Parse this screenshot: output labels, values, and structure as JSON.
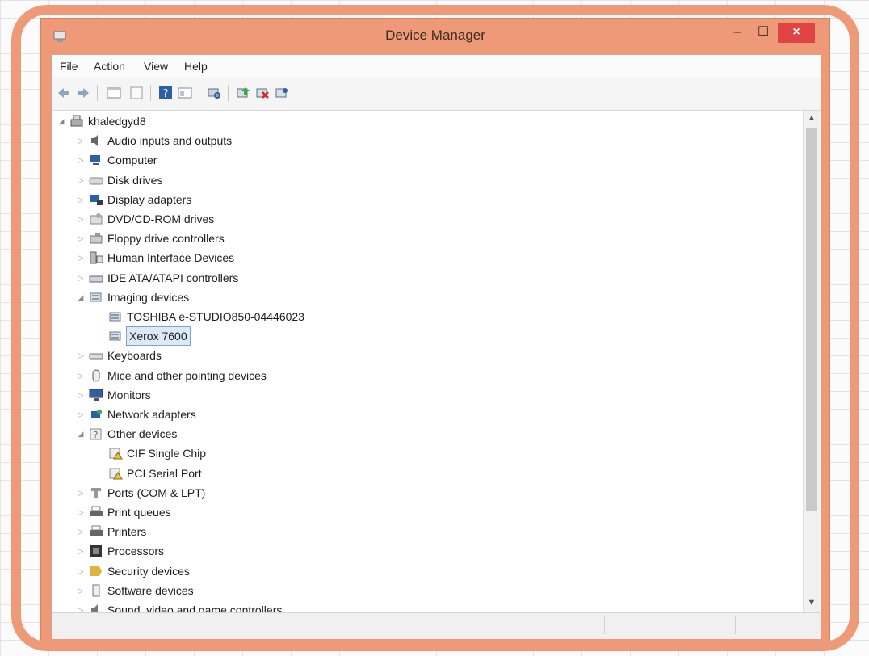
{
  "window": {
    "title": "Device Manager",
    "minimize_glyph": "–",
    "maximize_glyph": "☐",
    "close_glyph": "×"
  },
  "menu": [
    "File",
    "Action",
    "View",
    "Help"
  ],
  "toolbar": {
    "buttons": [
      "back-icon",
      "forward-icon",
      "properties-pane-icon",
      "blank-icon",
      "help-icon",
      "view-icon",
      "scan-hardware-icon",
      "update-driver-icon",
      "disable-device-icon",
      "uninstall-device-icon"
    ]
  },
  "tree": {
    "root": "khaledgyd8",
    "items": [
      {
        "label": "Audio inputs and outputs",
        "icon": "speaker-icon",
        "expanded": false
      },
      {
        "label": "Computer",
        "icon": "computer-icon",
        "expanded": false
      },
      {
        "label": "Disk drives",
        "icon": "disk-icon",
        "expanded": false
      },
      {
        "label": "Display adapters",
        "icon": "display-icon",
        "expanded": false
      },
      {
        "label": "DVD/CD-ROM drives",
        "icon": "dvd-icon",
        "expanded": false
      },
      {
        "label": "Floppy drive controllers",
        "icon": "floppy-icon",
        "expanded": false
      },
      {
        "label": "Human Interface Devices",
        "icon": "hid-icon",
        "expanded": false
      },
      {
        "label": "IDE ATA/ATAPI controllers",
        "icon": "ide-icon",
        "expanded": false
      },
      {
        "label": "Imaging devices",
        "icon": "scanner-icon",
        "expanded": true,
        "children": [
          {
            "label": "TOSHIBA e-STUDIO850-04446023",
            "icon": "scanner-icon"
          },
          {
            "label": "Xerox 7600",
            "icon": "scanner-icon",
            "selected": true
          }
        ]
      },
      {
        "label": "Keyboards",
        "icon": "keyboard-icon",
        "expanded": false
      },
      {
        "label": "Mice and other pointing devices",
        "icon": "mouse-icon",
        "expanded": false
      },
      {
        "label": "Monitors",
        "icon": "monitor-icon",
        "expanded": false
      },
      {
        "label": "Network adapters",
        "icon": "network-icon",
        "expanded": false
      },
      {
        "label": "Other devices",
        "icon": "unknown-device-icon",
        "expanded": true,
        "children": [
          {
            "label": "CIF Single Chip",
            "icon": "warning-device-icon"
          },
          {
            "label": "PCI Serial Port",
            "icon": "warning-device-icon"
          }
        ]
      },
      {
        "label": "Ports (COM & LPT)",
        "icon": "port-icon",
        "expanded": false
      },
      {
        "label": "Print queues",
        "icon": "printer-icon",
        "expanded": false
      },
      {
        "label": "Printers",
        "icon": "printer-icon",
        "expanded": false
      },
      {
        "label": "Processors",
        "icon": "processor-icon",
        "expanded": false
      },
      {
        "label": "Security devices",
        "icon": "security-icon",
        "expanded": false
      },
      {
        "label": "Software devices",
        "icon": "software-icon",
        "expanded": false
      },
      {
        "label": "Sound, video and game controllers",
        "icon": "sound-icon",
        "expanded": false
      }
    ]
  },
  "colors": {
    "frame": "#ee9a78",
    "close": "#e04343",
    "selection": "#dceaf7"
  }
}
